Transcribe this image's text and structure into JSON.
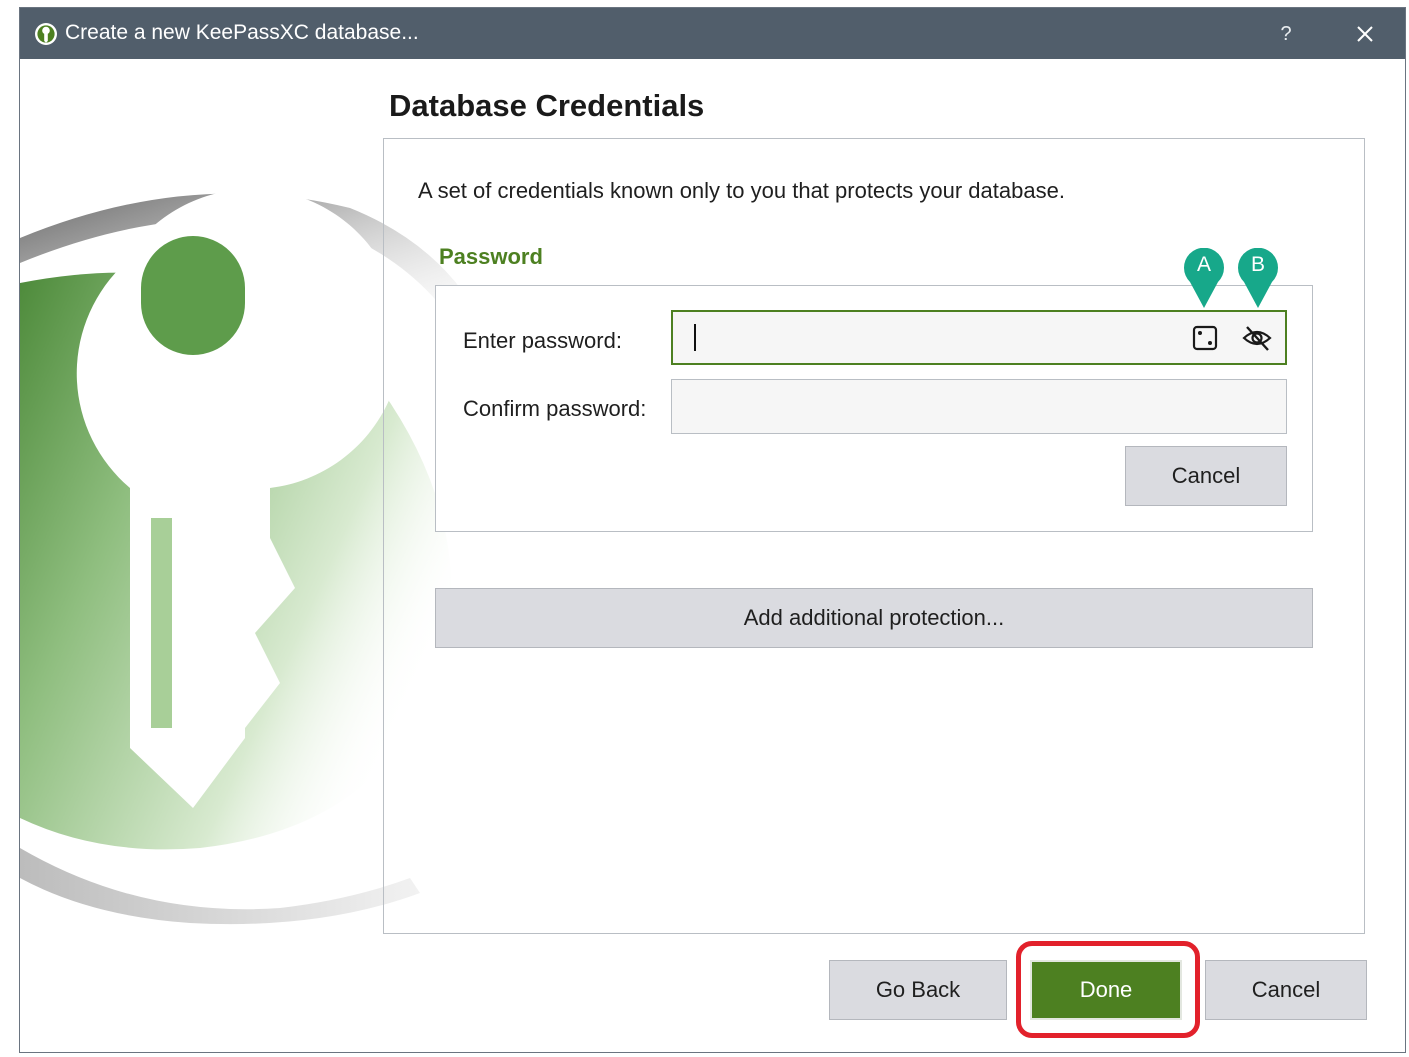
{
  "window": {
    "title": "Create a new KeePassXC database...",
    "help_label": "?",
    "accent_color": "#4d8021",
    "titlebar_color": "#515e6b"
  },
  "page": {
    "heading": "Database Credentials",
    "description": "A set of credentials known only to you that protects your database."
  },
  "password_group": {
    "title": "Password",
    "enter_label": "Enter password:",
    "confirm_label": "Confirm password:",
    "enter_value": "",
    "confirm_value": "",
    "generate_icon": "dice-icon",
    "toggle_icon": "eye-slash-icon",
    "cancel_label": "Cancel"
  },
  "markers": {
    "a_label": "A",
    "b_label": "B",
    "color": "#17a88a"
  },
  "additional_protection_label": "Add additional protection...",
  "footer": {
    "go_back_label": "Go Back",
    "done_label": "Done",
    "cancel_label": "Cancel",
    "highlight_color": "#e2212b"
  }
}
